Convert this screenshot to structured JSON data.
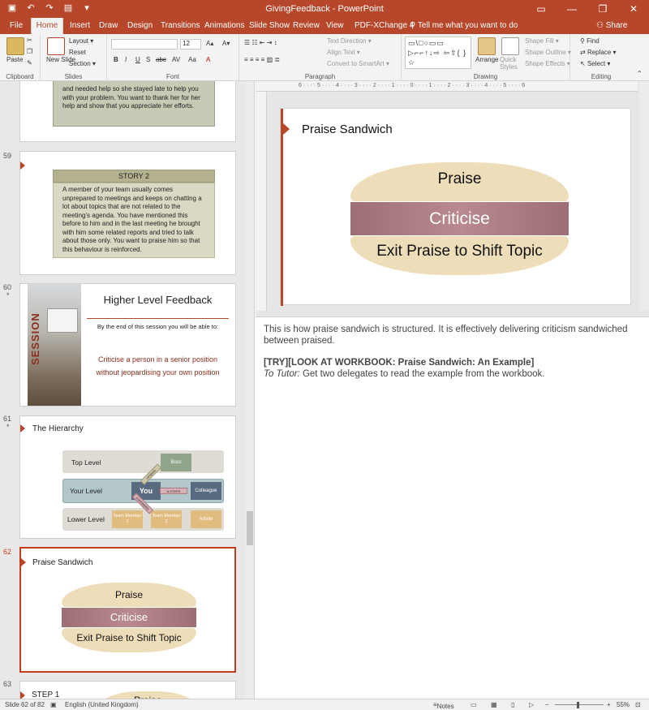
{
  "window": {
    "title": "GivingFeedback - PowerPoint",
    "minimize": "—",
    "restore": "❐",
    "close": "✕"
  },
  "qat": {
    "save_icon": "▣",
    "undo_icon": "↶",
    "redo_icon": "↷",
    "present_icon": "▤",
    "customize_icon": "▾"
  },
  "tabs": [
    "File",
    "Home",
    "Insert",
    "Draw",
    "Design",
    "Transitions",
    "Animations",
    "Slide Show",
    "Review",
    "View",
    "PDF-XChange 4"
  ],
  "active_tab": "Home",
  "tell_me": "Tell me what you want to do",
  "share": "Share",
  "ribbon": {
    "clipboard": {
      "label": "Clipboard",
      "paste": "Paste"
    },
    "slides": {
      "label": "Slides",
      "new_slide": "New Slide",
      "layout": "Layout",
      "reset": "Reset",
      "section": "Section"
    },
    "font": {
      "label": "Font",
      "size": "12",
      "buttons": [
        "B",
        "I",
        "U",
        "S",
        "abc",
        "AV",
        "Aa",
        "A"
      ]
    },
    "paragraph": {
      "label": "Paragraph",
      "text_direction": "Text Direction",
      "align_text": "Align Text",
      "smartart": "Convert to SmartArt"
    },
    "drawing": {
      "label": "Drawing",
      "arrange": "Arrange",
      "quick_styles": "Quick Styles",
      "shape_fill": "Shape Fill",
      "shape_outline": "Shape Outline",
      "shape_effects": "Shape Effects",
      "shapes_glyphs": "▭\\□○▭▭ ▷⌐⌐↑↓⇨ ⇦⇧{ }☆"
    },
    "editing": {
      "label": "Editing",
      "find": "Find",
      "replace": "Replace",
      "select": "Select"
    }
  },
  "thumbnails": {
    "s58": {
      "text": "and needed help so she stayed late to help you with your problem. You want to thank her for her help and show that you appreciate her efforts."
    },
    "s59": {
      "num": "59",
      "heading": "STORY 2",
      "text": "A member of your team usually comes unprepared to meetings and keeps on chatting a lot about topics that are not related to the meeting's agenda. You have mentioned this before to him and in the last meeting he brought with him some related reports and tried to talk about those only. You want to praise him so that this behaviour is reinforced."
    },
    "s60": {
      "num": "60",
      "star": "*",
      "title": "Higher Level Feedback",
      "sub": "By the end of this session you will be able to:",
      "body1": "Criticise a person in a senior position",
      "body2": "without jeopardising your own position",
      "session_word": "SESSION"
    },
    "s61": {
      "num": "61",
      "star": "*",
      "title": "The Hierarchy",
      "top": "Top Level",
      "your": "Your Level",
      "lower": "Lower Level",
      "boss": "Boss",
      "you": "You",
      "colleague": "Colleague",
      "tm1": "Team Member 1",
      "tm2": "Team Member 2",
      "admin": "Admin",
      "steps": "A STEPS",
      "arrow_up": "UPWARD",
      "arrow_down": "DOWNWARD"
    },
    "s62": {
      "num": "62",
      "title": "Praise Sandwich",
      "praise": "Praise",
      "criticise": "Criticise",
      "exit": "Exit Praise to Shift Topic"
    },
    "s63": {
      "num": "63",
      "title": "STEP 1",
      "praise": "Praise"
    }
  },
  "main_slide": {
    "title": "Praise Sandwich",
    "praise": "Praise",
    "criticise": "Criticise",
    "exit": "Exit Praise to Shift Topic"
  },
  "notes": {
    "line1": "This is how praise sandwich is structured. It is effectively delivering criticism sandwiched between praised.",
    "line2": "[TRY][LOOK AT WORKBOOK: Praise Sandwich: An Example]",
    "line3_prefix": "To Tutor:",
    "line3": " Get two delegates to read the example from the workbook."
  },
  "status": {
    "slide": "Slide 62 of 82",
    "language": "English (United Kingdom)",
    "notes": "Notes",
    "zoom": "55%"
  },
  "colors": {
    "accent": "#b7472a",
    "bun": "#eeddb9",
    "filling": "#a47479"
  }
}
